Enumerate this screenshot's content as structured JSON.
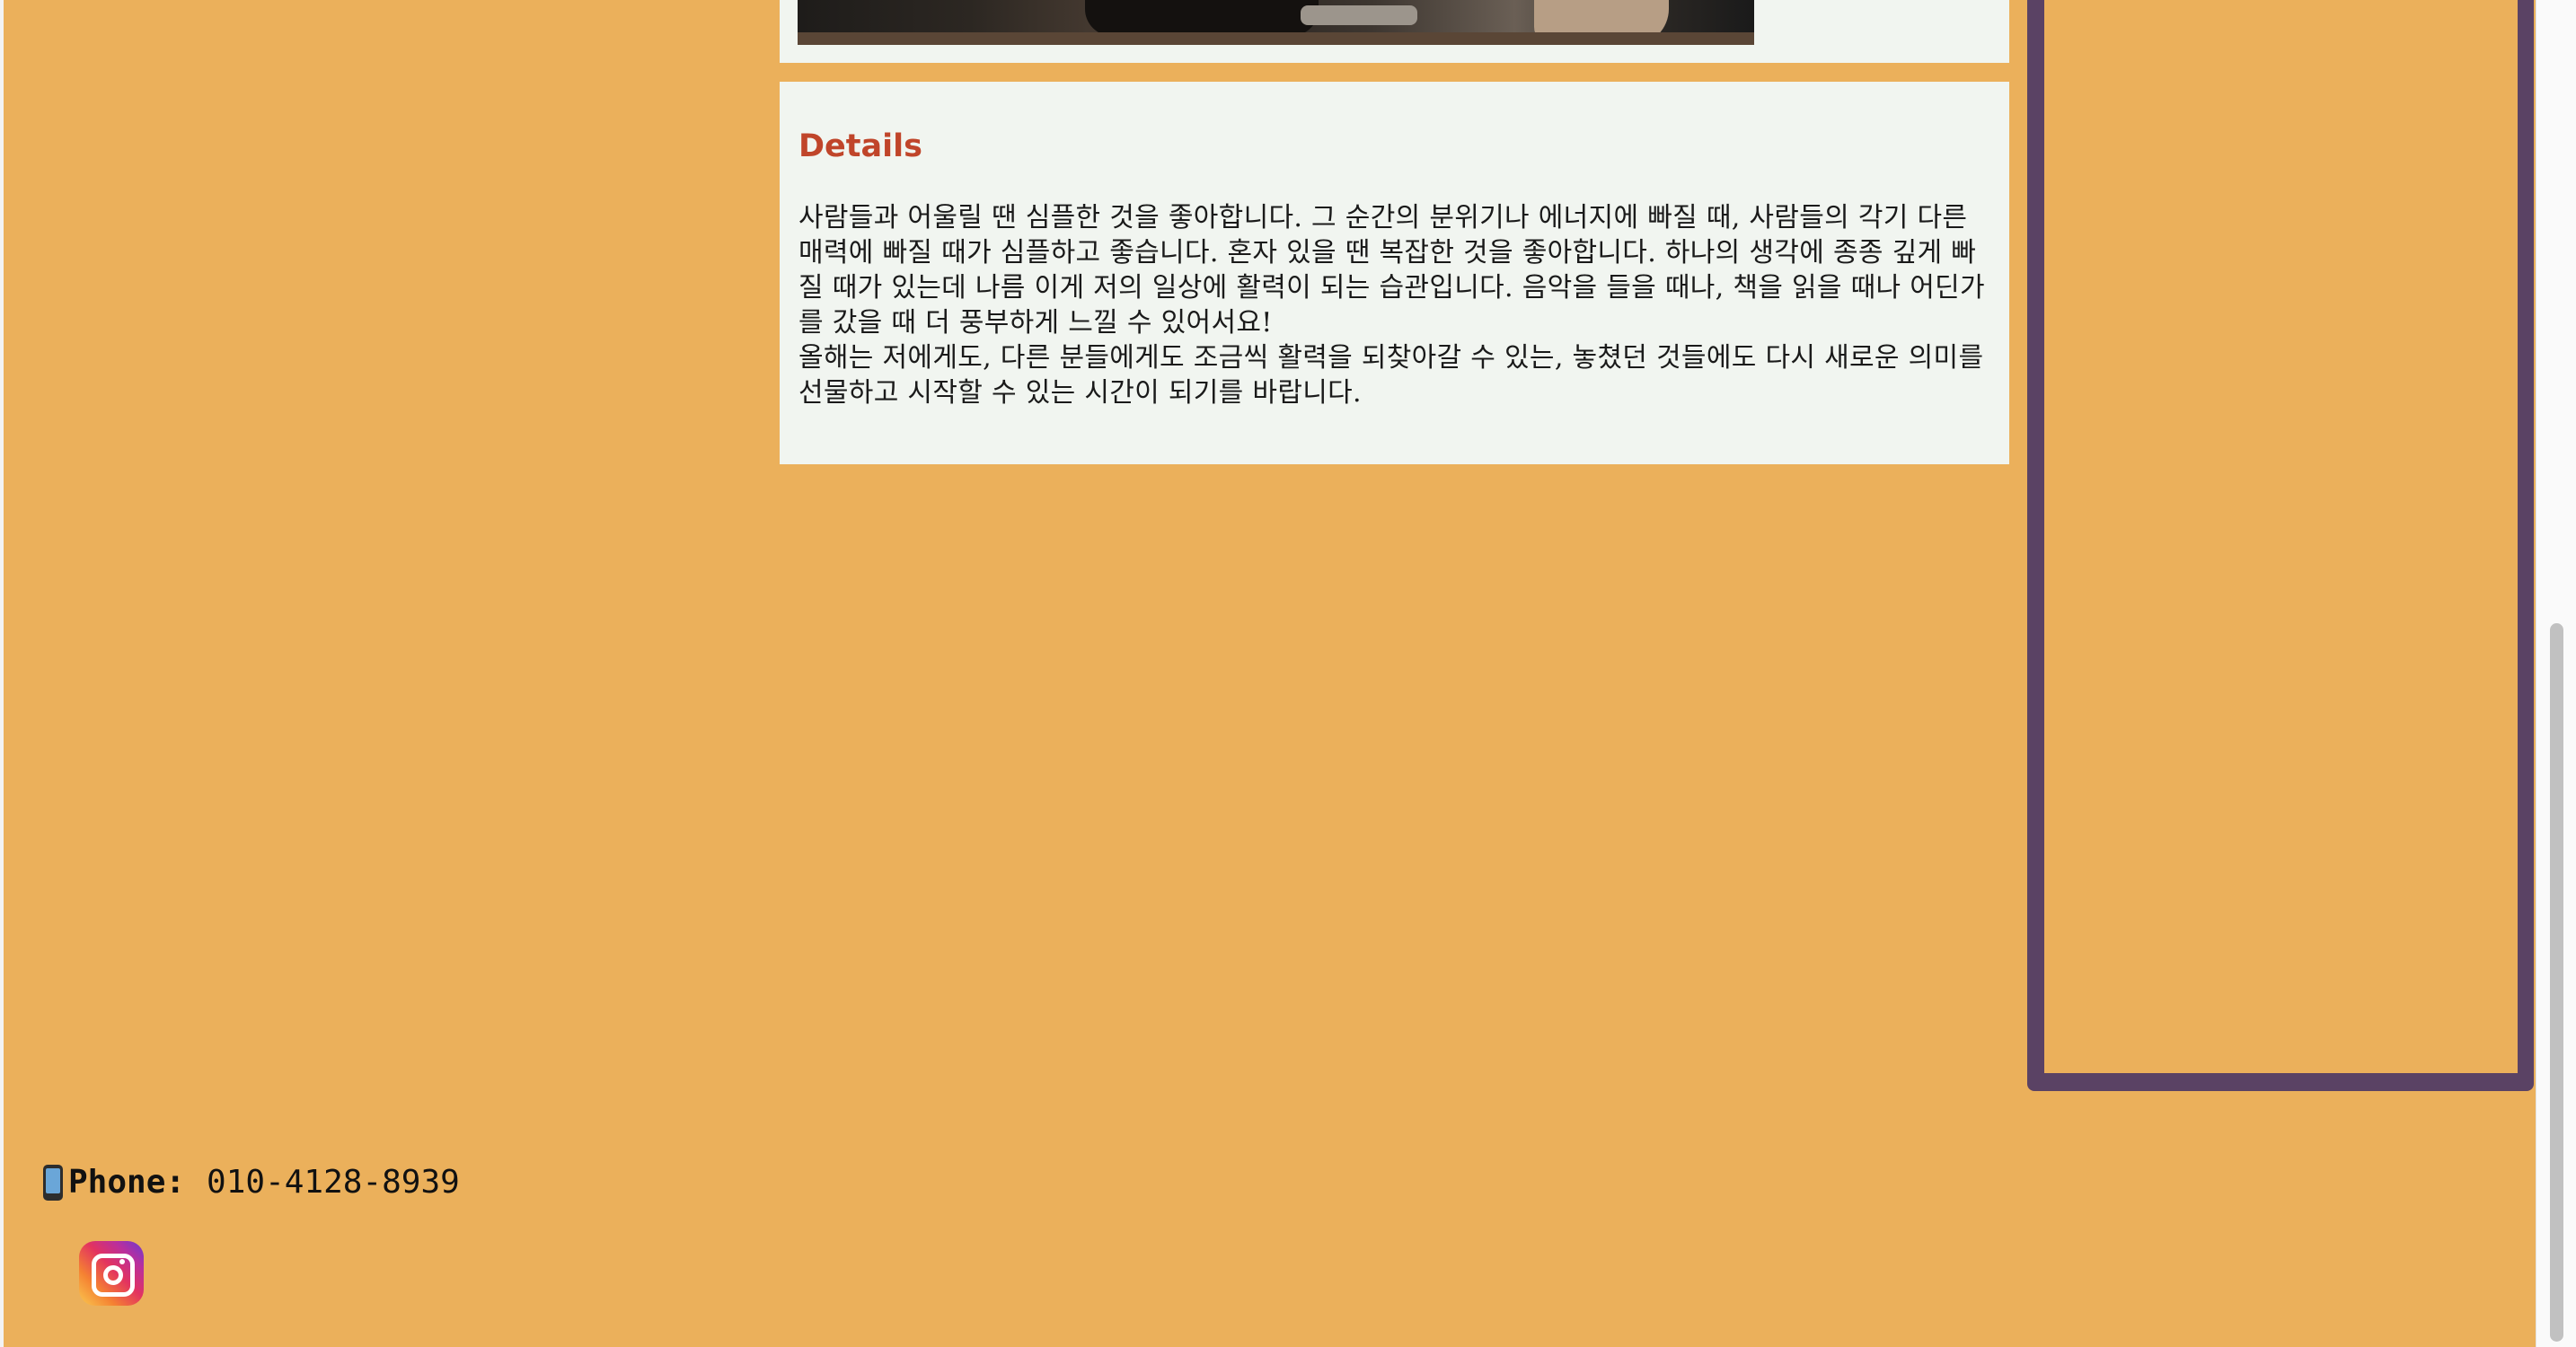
{
  "details": {
    "title": "Details",
    "paragraphs": [
      "사람들과 어울릴 땐 심플한 것을 좋아합니다. 그 순간의 분위기나 에너지에 빠질 때, 사람들의 각기 다른 매력에 빠질 때가 심플하고 좋습니다. 혼자 있을 땐 복잡한 것을 좋아합니다. 하나의 생각에 종종 깊게 빠질 때가 있는데 나름 이게 저의 일상에 활력이 되는 습관입니다. 음악을 들을 때나, 책을 읽을 때나 어딘가를 갔을 때 더 풍부하게 느낄 수 있어서요!",
      "올해는 저에게도, 다른 분들에게도 조금씩 활력을 되찾아갈 수 있는, 놓쳤던 것들에도 다시 새로운 의미를 선물하고 시작할 수 있는 시간이 되기를 바랍니다."
    ]
  },
  "footer": {
    "phone_label": "Phone:",
    "phone_number": "010-4128-8939",
    "phone_icon": "mobile-phone-icon",
    "social_icon": "instagram-icon"
  },
  "colors": {
    "background": "#ebb05b",
    "card": "#f1f5f0",
    "heading": "#c0452a",
    "panel_border": "#5a4264"
  }
}
